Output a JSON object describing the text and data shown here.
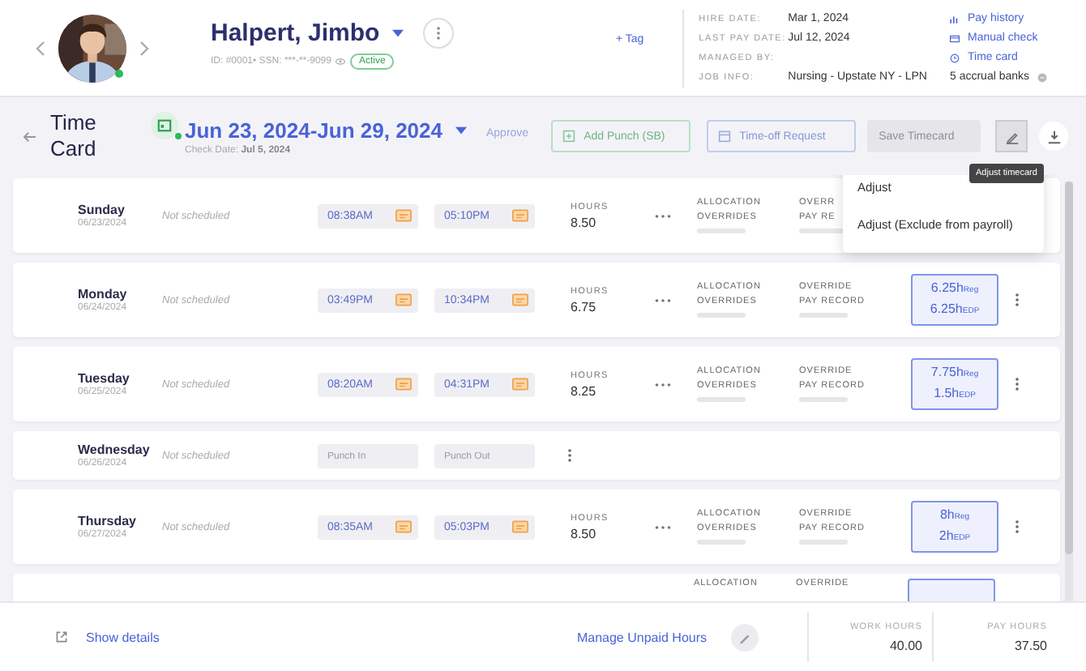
{
  "employee": {
    "name": "Halpert, Jimbo",
    "id_line": "ID: #0001• SSN: ***-**-9099",
    "status": "Active",
    "online": true,
    "tag_link": "+ Tag"
  },
  "info": [
    {
      "label": "HIRE DATE:",
      "value": "Mar 1, 2024"
    },
    {
      "label": "LAST PAY DATE:",
      "value": "Jul 12, 2024"
    },
    {
      "label": "MANAGED BY:"
    },
    {
      "label": "JOB INFO:",
      "value": "Nursing - Upstate NY - LPN"
    }
  ],
  "links": [
    {
      "kind": "history",
      "label": "Pay history"
    },
    {
      "kind": "check",
      "label": "Manual check"
    },
    {
      "kind": "clock",
      "label": "Time card"
    },
    {
      "kind": "banks",
      "label": "5 accrual banks"
    }
  ],
  "toolbar": {
    "title": "Time Card",
    "date_range": "Jun 23, 2024-Jun 29, 2024",
    "check_date": "Check Date: **Jul 5, 2024**",
    "approve": "Approve",
    "add_punch": "Add Punch (SB)",
    "time_off": "Time-off Request",
    "save": "Save Timecard",
    "edit_active": true
  },
  "menu": {
    "items": [
      "Adjust",
      "Adjust (Exclude from payroll)"
    ],
    "tooltip": "Adjust timecard"
  },
  "rows": [
    {
      "kind": "full",
      "day": "Sunday",
      "date": "06/23/2024",
      "schedule": "Not scheduled",
      "punch_in": "08:38AM",
      "punch_out": "05:10PM",
      "hours_label": "HOURS",
      "hours": "8.50",
      "alloc": [
        "ALLOCATION",
        "OVERRIDES"
      ],
      "override": [
        "OVERR",
        "PAY RE"
      ],
      "pay": []
    },
    {
      "kind": "full",
      "day": "Monday",
      "date": "06/24/2024",
      "schedule": "Not scheduled",
      "punch_in": "03:49PM",
      "punch_out": "10:34PM",
      "hours_label": "HOURS",
      "hours": "6.75",
      "alloc": [
        "ALLOCATION",
        "OVERRIDES"
      ],
      "override": [
        "OVERRIDE",
        "PAY RECORD"
      ],
      "pay": [
        {
          "amount": "6.25h",
          "code": "Reg"
        },
        {
          "amount": "6.25h",
          "code": "EDP"
        }
      ]
    },
    {
      "kind": "full",
      "day": "Tuesday",
      "date": "06/25/2024",
      "schedule": "Not scheduled",
      "punch_in": "08:20AM",
      "punch_out": "04:31PM",
      "hours_label": "HOURS",
      "hours": "8.25",
      "alloc": [
        "ALLOCATION",
        "OVERRIDES"
      ],
      "override": [
        "OVERRIDE",
        "PAY RECORD"
      ],
      "pay": [
        {
          "amount": "7.75h",
          "code": "Reg"
        },
        {
          "amount": "1.5h",
          "code": "EDP"
        }
      ]
    },
    {
      "kind": "empty",
      "day": "Wednesday",
      "date": "06/26/2024",
      "schedule": "Not scheduled",
      "punch_in_placeholder": "Punch In",
      "punch_out_placeholder": "Punch Out"
    },
    {
      "kind": "full",
      "day": "Thursday",
      "date": "06/27/2024",
      "schedule": "Not scheduled",
      "punch_in": "08:35AM",
      "punch_out": "05:03PM",
      "hours_label": "HOURS",
      "hours": "8.50",
      "alloc": [
        "ALLOCATION",
        "OVERRIDES"
      ],
      "override": [
        "OVERRIDE",
        "PAY RECORD"
      ],
      "pay": [
        {
          "amount": "8h",
          "code": "Reg"
        },
        {
          "amount": "2h",
          "code": "EDP"
        }
      ]
    },
    {
      "kind": "partial",
      "alloc": [
        "ALLOCATION"
      ],
      "override": [
        "OVERRIDE"
      ]
    }
  ],
  "footer": {
    "details": "Show details",
    "manage": "Manage Unpaid Hours",
    "totals": [
      {
        "label": "WORK HOURS",
        "value": "40.00"
      },
      {
        "label": "PAY HOURS",
        "value": "37.50"
      }
    ]
  }
}
